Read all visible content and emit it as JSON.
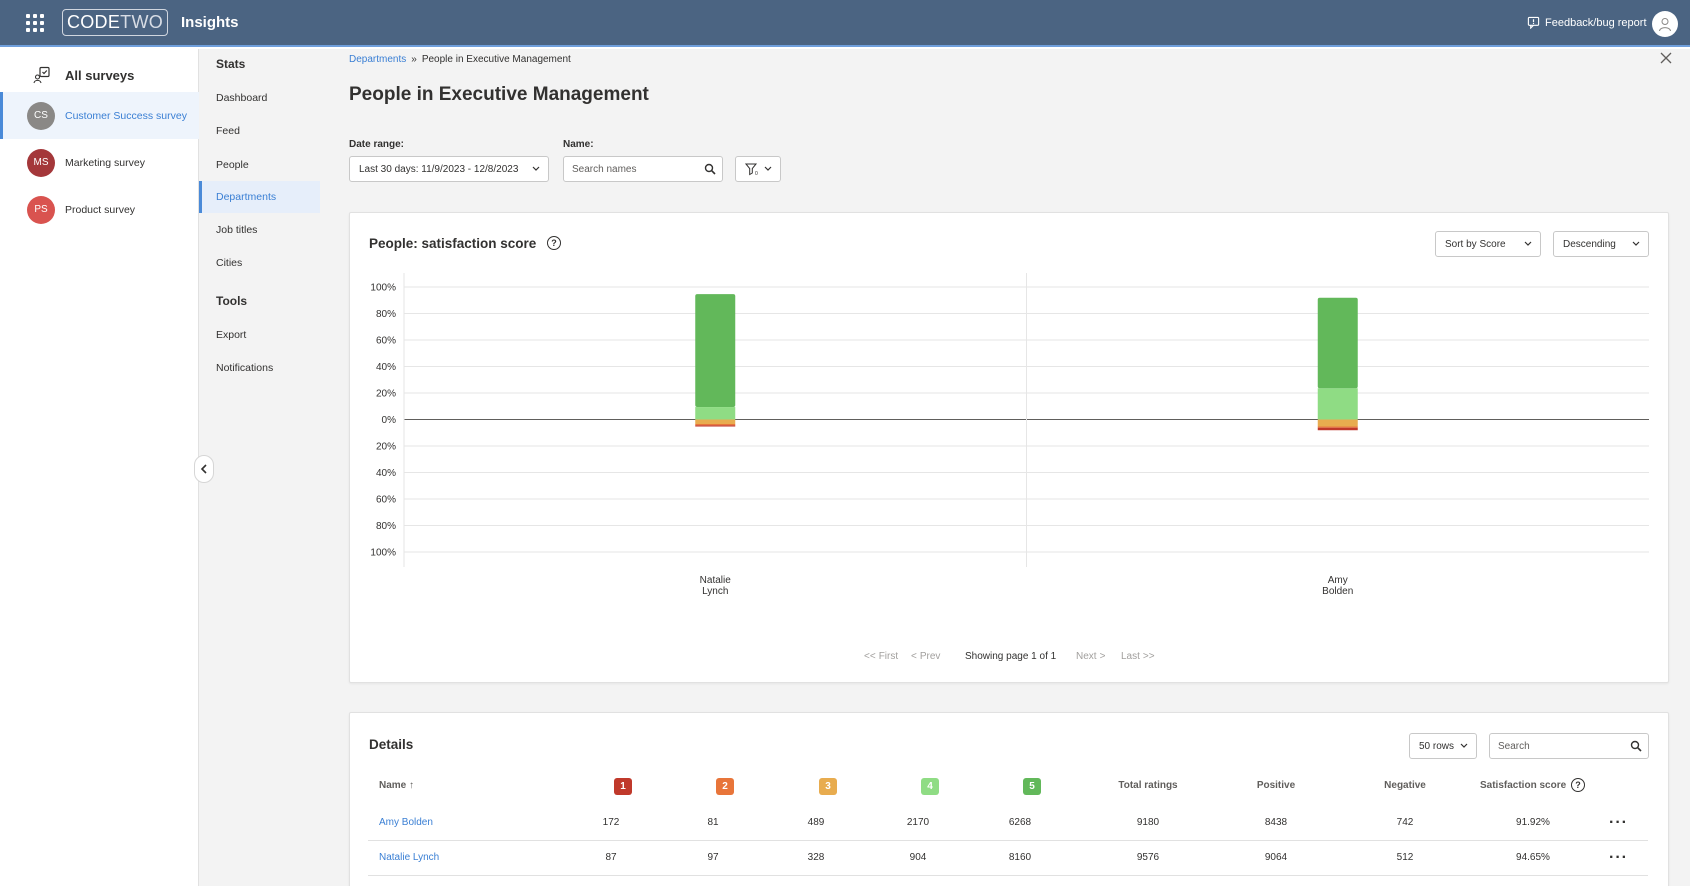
{
  "header": {
    "logo_left": "CODE",
    "logo_right": "TWO",
    "app_title": "Insights",
    "feedback_label": "Feedback/bug report"
  },
  "surveys": {
    "all_label": "All surveys",
    "items": [
      {
        "initials": "CS",
        "label": "Customer Success survey",
        "color": "#8a8886",
        "active": true
      },
      {
        "initials": "MS",
        "label": "Marketing survey",
        "color": "#a4373a",
        "active": false
      },
      {
        "initials": "PS",
        "label": "Product survey",
        "color": "#d9534f",
        "active": false
      }
    ]
  },
  "nav": {
    "stats_heading": "Stats",
    "stats_items": [
      "Dashboard",
      "Feed",
      "People",
      "Departments",
      "Job titles",
      "Cities"
    ],
    "tools_heading": "Tools",
    "tools_items": [
      "Export",
      "Notifications"
    ],
    "active": "Departments"
  },
  "breadcrumb": {
    "parent": "Departments",
    "separator": "»",
    "current": "People in Executive Management"
  },
  "page_title": "People in Executive Management",
  "filters": {
    "date_label": "Date range:",
    "date_value": "Last 30 days: 11/9/2023 - 12/8/2023",
    "name_label": "Name:",
    "name_placeholder": "Search names"
  },
  "chart_card": {
    "title": "People: satisfaction score",
    "sort_value": "Sort by Score",
    "order_value": "Descending",
    "pager": {
      "first": "First",
      "prev": "Prev",
      "status": "Showing page 1 of 1",
      "next": "Next",
      "last": "Last"
    }
  },
  "chart_data": {
    "type": "bar",
    "stacked": true,
    "diverging": true,
    "categories": [
      "Natalie Lynch",
      "Amy Bolden"
    ],
    "category_lines": [
      [
        "Natalie",
        "Lynch"
      ],
      [
        "Amy",
        "Bolden"
      ]
    ],
    "ylim": [
      -100,
      100
    ],
    "ticks": [
      "100%",
      "80%",
      "60%",
      "40%",
      "20%",
      "0%",
      "20%",
      "40%",
      "60%",
      "80%",
      "100%"
    ],
    "series": [
      {
        "name": "1",
        "color": "#c0392b",
        "values": [
          -0.9,
          -1.9
        ]
      },
      {
        "name": "2",
        "color": "#e8753a",
        "values": [
          -1.0,
          -0.9
        ]
      },
      {
        "name": "3",
        "color": "#e8ac4f",
        "values": [
          -3.4,
          -5.3
        ]
      },
      {
        "name": "4",
        "color": "#8fdc84",
        "values": [
          9.4,
          23.6
        ]
      },
      {
        "name": "5",
        "color": "#62b85a",
        "values": [
          85.2,
          68.3
        ]
      }
    ],
    "grid": true
  },
  "details": {
    "title": "Details",
    "rows_value": "50 rows",
    "search_placeholder": "Search",
    "columns": {
      "name": "Name ↑",
      "r1": "1",
      "r2": "2",
      "r3": "3",
      "r4": "4",
      "r5": "5",
      "total": "Total ratings",
      "positive": "Positive",
      "negative": "Negative",
      "score": "Satisfaction score"
    },
    "rating_colors": [
      "#c0392b",
      "#e8753a",
      "#e8ac4f",
      "#8fdc84",
      "#62b85a"
    ],
    "rows": [
      {
        "name": "Amy Bolden",
        "r1": "172",
        "r2": "81",
        "r3": "489",
        "r4": "2170",
        "r5": "6268",
        "total": "9180",
        "positive": "8438",
        "negative": "742",
        "score": "91.92%"
      },
      {
        "name": "Natalie Lynch",
        "r1": "87",
        "r2": "97",
        "r3": "328",
        "r4": "904",
        "r5": "8160",
        "total": "9576",
        "positive": "9064",
        "negative": "512",
        "score": "94.65%"
      }
    ]
  }
}
